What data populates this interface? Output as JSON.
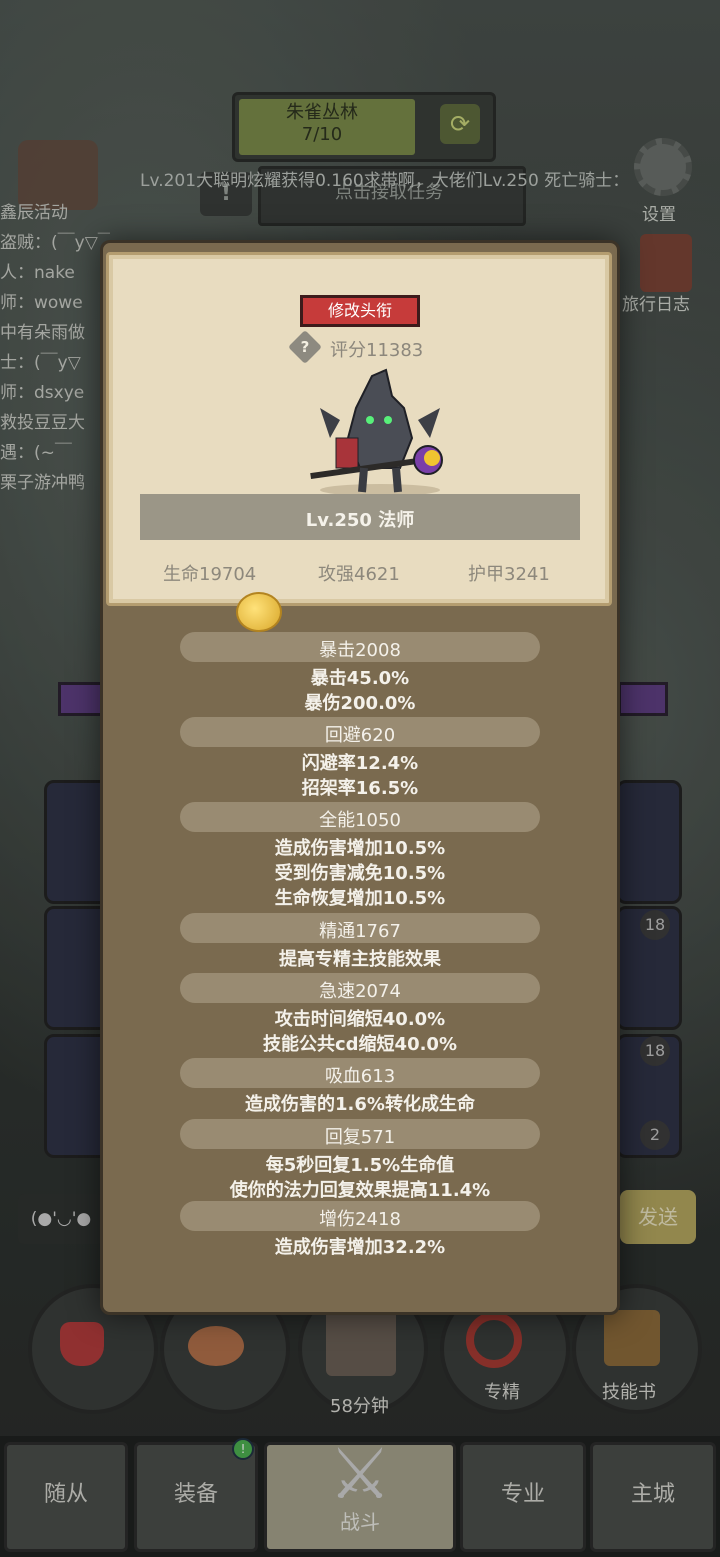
{
  "background": {
    "quest": {
      "name": "朱雀丛林",
      "progress": "7/10",
      "accept": "点击接取任务"
    },
    "ticker": "Lv.201大聪明炫耀获得0.160求带啊，大佬们Lv.250 死亡骑士：",
    "left_menu_label": "鑫辰活动",
    "chat_lines": [
      "盗贼：(￣y▽￣)",
      "人：nake",
      "师：wowe",
      "中有朵雨做",
      "士：(￣y▽",
      "师：dsxye",
      "救投豆豆大",
      "遇：(~￣",
      "栗子游冲鸭"
    ],
    "settings_label": "设置",
    "travel_log_label": "旅行日志",
    "slot_badges": [
      "18",
      "18",
      "2"
    ],
    "chat_input": "(●'◡'●",
    "send_label": "发送",
    "round_buttons": {
      "chest_timer": "58分钟",
      "spec": "专精",
      "skill_book": "技能书"
    },
    "tabs": [
      {
        "label": "随从"
      },
      {
        "label": "装备"
      },
      {
        "label": "战斗"
      },
      {
        "label": "专业"
      },
      {
        "label": "主城"
      }
    ]
  },
  "modal": {
    "title_button": "修改头衔",
    "score": "评分11383",
    "hero_name": "Lv.250 法师",
    "base_stats": {
      "hp": "生命19704",
      "attack": "攻强4621",
      "armor": "护甲3241"
    },
    "sections": [
      {
        "title": "暴击2008",
        "lines": [
          "暴击45.0%",
          "暴伤200.0%"
        ]
      },
      {
        "title": "回避620",
        "lines": [
          "闪避率12.4%",
          "招架率16.5%"
        ]
      },
      {
        "title": "全能1050",
        "lines": [
          "造成伤害增加10.5%",
          "受到伤害减免10.5%",
          "生命恢复增加10.5%"
        ]
      },
      {
        "title": "精通1767",
        "lines": [
          "提高专精主技能效果"
        ]
      },
      {
        "title": "急速2074",
        "lines": [
          "攻击时间缩短40.0%",
          "技能公共cd缩短40.0%"
        ]
      },
      {
        "title": "吸血613",
        "lines": [
          "造成伤害的1.6%转化成生命"
        ]
      },
      {
        "title": "回复571",
        "lines": [
          "每5秒回复1.5%生命值",
          "使你的法力回复效果提高11.4%"
        ]
      },
      {
        "title": "增伤2418",
        "lines": [
          "造成伤害增加32.2%"
        ]
      }
    ]
  }
}
